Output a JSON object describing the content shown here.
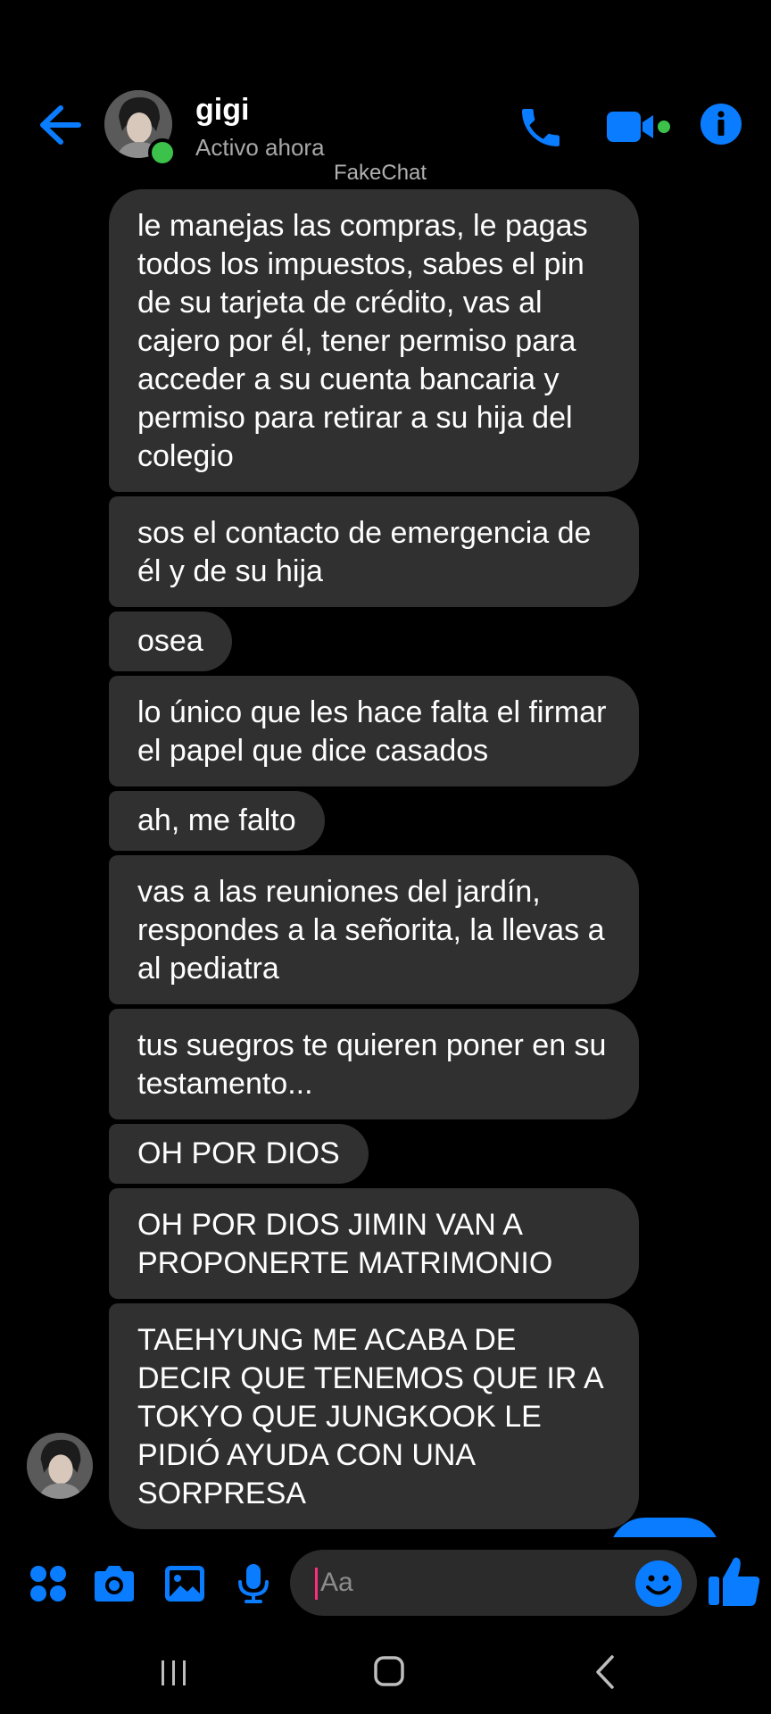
{
  "header": {
    "contact_name": "gigi",
    "status": "Activo ahora",
    "watermark": "FakeChat"
  },
  "messages": [
    "le manejas las compras, le pagas todos los impuestos, sabes el pin de su tarjeta de crédito, vas al cajero por él, tener permiso para acceder a su cuenta bancaria y permiso para retirar a su hija del colegio",
    "sos el contacto de emergencia de él y de su hija",
    "osea",
    "lo único que les hace falta el firmar el papel que dice casados",
    "ah, me falto",
    "vas a las reuniones del jardín, respondes a la señorita, la llevas a al pediatra",
    "tus suegros te quieren poner en su testamento...",
    "OH POR DIOS",
    "OH POR DIOS JIMIN VAN A PROPONERTE MATRIMONIO",
    "TAEHYUNG ME ACABA DE DECIR QUE TENEMOS QUE IR A TOKYO QUE JUNGKOOK LE PIDIÓ AYUDA CON UNA SORPRESA"
  ],
  "composer": {
    "placeholder": "Aa"
  },
  "icons": {
    "back": "arrow-left-icon",
    "call": "phone-icon",
    "video": "video-camera-icon",
    "info": "info-icon",
    "apps": "grid-dots-icon",
    "camera": "camera-icon",
    "gallery": "image-icon",
    "mic": "microphone-icon",
    "emoji": "smiley-icon",
    "like": "thumbs-up-icon"
  },
  "colors": {
    "accent": "#0a7cff",
    "bubble": "#303030",
    "online": "#3cc14a",
    "background": "#000000"
  }
}
